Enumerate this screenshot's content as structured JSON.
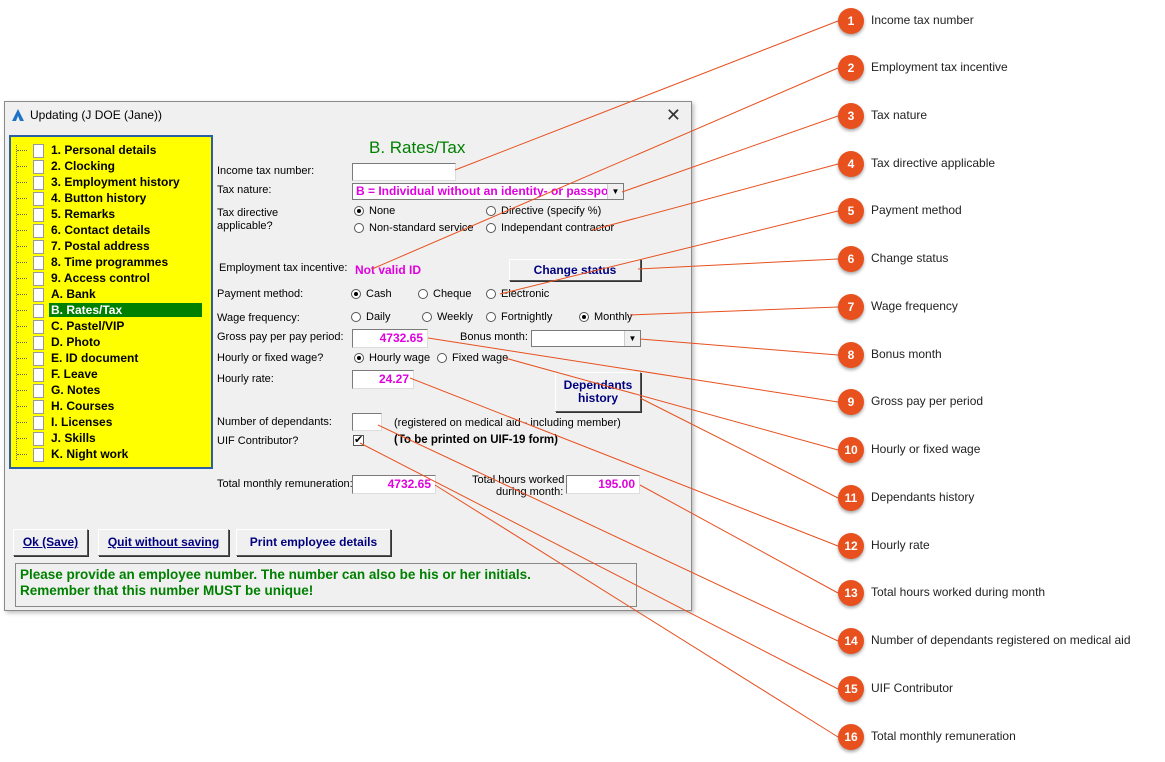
{
  "window": {
    "title": "Updating  (J DOE (Jane))",
    "close": "✕"
  },
  "nav": {
    "items": [
      {
        "label": "1. Personal details"
      },
      {
        "label": "2. Clocking"
      },
      {
        "label": "3. Employment history"
      },
      {
        "label": "4. Button history"
      },
      {
        "label": "5. Remarks"
      },
      {
        "label": "6. Contact details"
      },
      {
        "label": "7. Postal address"
      },
      {
        "label": "8. Time programmes"
      },
      {
        "label": "9. Access control"
      },
      {
        "label": "A. Bank"
      },
      {
        "label": "B. Rates/Tax",
        "active": true
      },
      {
        "label": "C. Pastel/VIP"
      },
      {
        "label": "D. Photo"
      },
      {
        "label": "E. ID document"
      },
      {
        "label": "F. Leave"
      },
      {
        "label": "G. Notes"
      },
      {
        "label": "H. Courses"
      },
      {
        "label": "I. Licenses"
      },
      {
        "label": "J. Skills"
      },
      {
        "label": "K. Night work"
      }
    ]
  },
  "form": {
    "heading": "B. Rates/Tax",
    "income_tax_label": "Income tax number:",
    "income_tax_value": "",
    "tax_nature_label": "Tax nature:",
    "tax_nature_value": "B = Individual without an identity- or passpo",
    "tax_directive_label_1": "Tax directive",
    "tax_directive_label_2": "applicable?",
    "directive_options": [
      "None",
      "Directive (specify %)",
      "Non-standard service",
      "Independant contractor"
    ],
    "employment_incentive_label": "Employment tax incentive:",
    "employment_incentive_value": "Not valid ID",
    "change_status_button": "Change status",
    "payment_method_label": "Payment method:",
    "payment_options": [
      "Cash",
      "Cheque",
      "Electronic"
    ],
    "wage_frequency_label": "Wage frequency:",
    "wage_options": [
      "Daily",
      "Weekly",
      "Fortnightly",
      "Monthly"
    ],
    "gross_pay_label": "Gross pay per pay period:",
    "gross_pay_value": "4732.65",
    "bonus_month_label": "Bonus month:",
    "bonus_month_value": "",
    "hourly_fixed_label": "Hourly or fixed wage?",
    "hourly_fixed_options": [
      "Hourly wage",
      "Fixed wage"
    ],
    "hourly_rate_label": "Hourly rate:",
    "hourly_rate_value": "24.27",
    "dependants_history_button_1": "Dependants",
    "dependants_history_button_2": "history",
    "dependants_label": "Number of dependants:",
    "dependants_value": "",
    "dependants_note": "(registered on medical aid - including member)",
    "uif_label": "UIF Contributor?",
    "uif_checked": "✔",
    "uif_note": "(To be printed on UIF-19 form)",
    "total_rem_label": "Total monthly remuneration:",
    "total_rem_value": "4732.65",
    "total_hours_label_1": "Total hours worked",
    "total_hours_label_2": "during month:",
    "total_hours_value": "195.00"
  },
  "buttons": {
    "ok": "Ok (Save)",
    "quit": "Quit without saving",
    "print": "Print employee details"
  },
  "message": {
    "line1": "Please provide an employee number. The number can also be his or her initials.",
    "line2": "Remember that this number MUST be unique!"
  },
  "callouts": [
    {
      "n": "1",
      "label": "Income tax number"
    },
    {
      "n": "2",
      "label": "Employment tax incentive"
    },
    {
      "n": "3",
      "label": "Tax nature"
    },
    {
      "n": "4",
      "label": "Tax directive applicable"
    },
    {
      "n": "5",
      "label": "Payment method"
    },
    {
      "n": "6",
      "label": "Change status"
    },
    {
      "n": "7",
      "label": "Wage frequency"
    },
    {
      "n": "8",
      "label": "Bonus month"
    },
    {
      "n": "9",
      "label": "Gross pay per period"
    },
    {
      "n": "10",
      "label": "Hourly or fixed wage"
    },
    {
      "n": "11",
      "label": "Dependants history"
    },
    {
      "n": "12",
      "label": "Hourly rate"
    },
    {
      "n": "13",
      "label": "Total hours worked during month"
    },
    {
      "n": "14",
      "label": "Number of dependants registered on medical aid"
    },
    {
      "n": "15",
      "label": "UIF Contributor"
    },
    {
      "n": "16",
      "label": "Total monthly remuneration"
    }
  ],
  "colors": {
    "callout": "#e8501e",
    "nav_bg": "#ffff00",
    "nav_active": "#008000",
    "value_text": "#e000e0",
    "heading": "#008000",
    "button_text": "#000080"
  }
}
